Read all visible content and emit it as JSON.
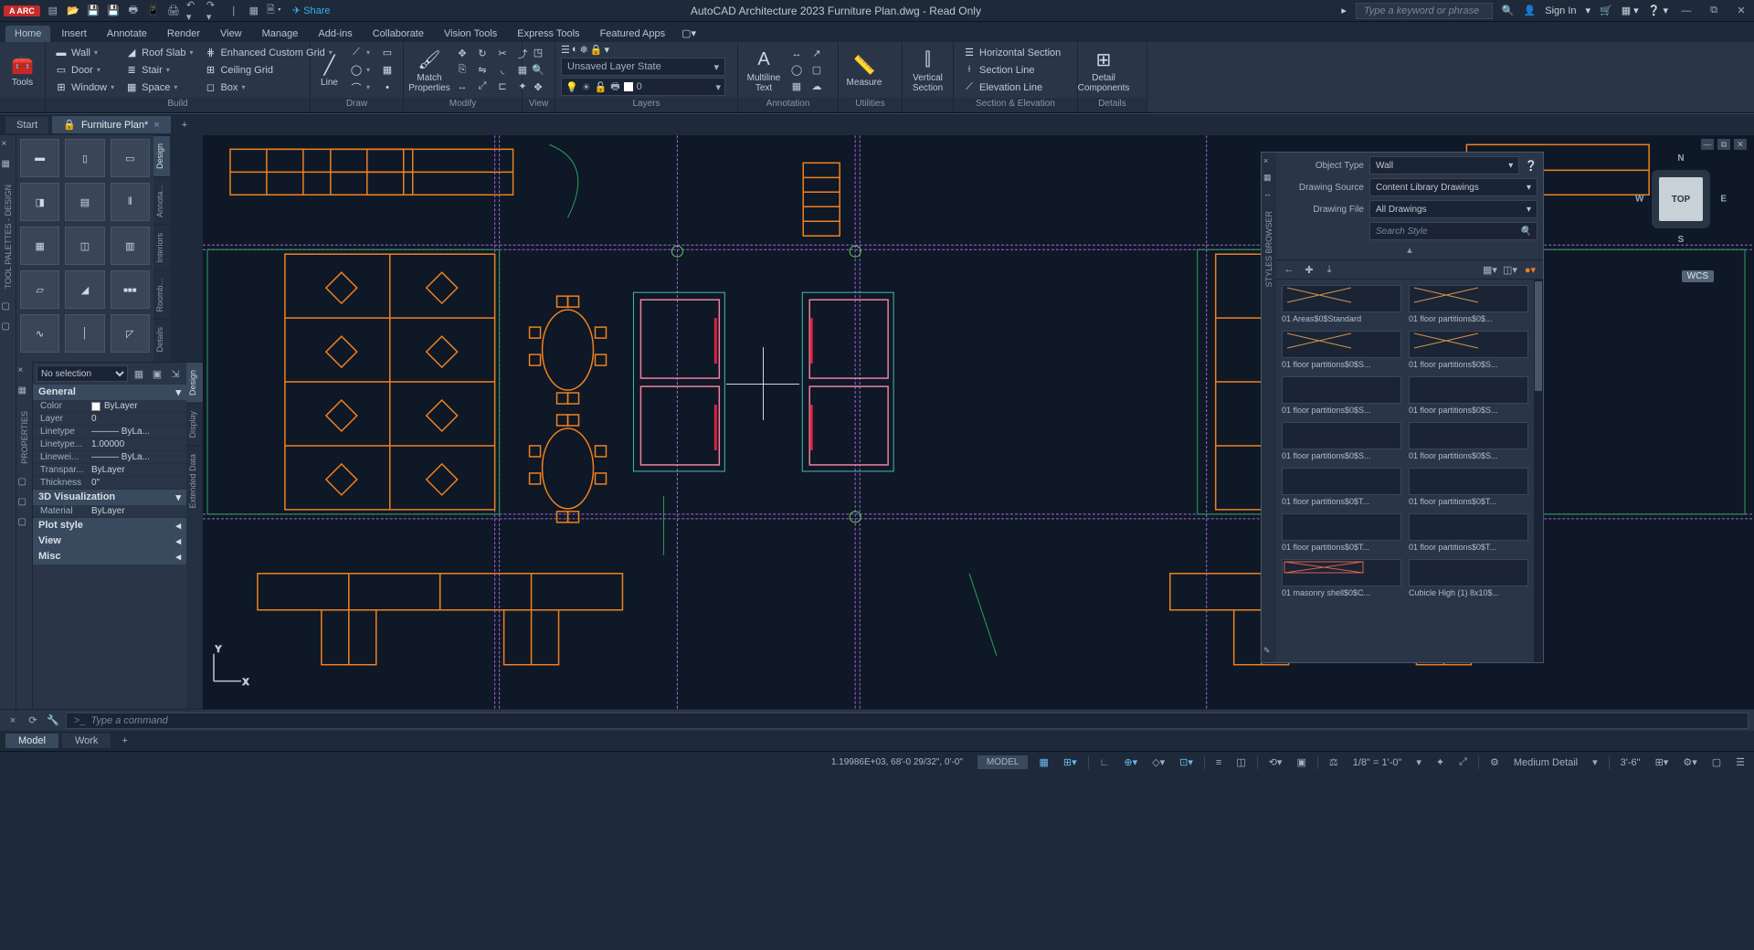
{
  "app": {
    "badge": "A ARC",
    "title": "AutoCAD Architecture 2023   Furniture Plan.dwg - Read Only",
    "share_label": "Share",
    "search_placeholder": "Type a keyword or phrase",
    "signin": "Sign In"
  },
  "menu": {
    "tabs": [
      "Home",
      "Insert",
      "Annotate",
      "Render",
      "View",
      "Manage",
      "Add-ins",
      "Collaborate",
      "Vision Tools",
      "Express Tools",
      "Featured Apps"
    ]
  },
  "ribbon": {
    "tools": "Tools",
    "build": {
      "label": "Build",
      "rows": [
        {
          "icon": "▬",
          "label": "Wall"
        },
        {
          "icon": "▭",
          "label": "Door"
        },
        {
          "icon": "⊞",
          "label": "Window"
        }
      ],
      "rows2": [
        {
          "icon": "◢",
          "label": "Roof Slab"
        },
        {
          "icon": "≣",
          "label": "Stair"
        },
        {
          "icon": "▦",
          "label": "Space"
        }
      ],
      "rows3": [
        {
          "icon": "⋕",
          "label": "Enhanced Custom Grid"
        },
        {
          "icon": "⊞",
          "label": "Ceiling Grid"
        },
        {
          "icon": "◻",
          "label": "Box"
        }
      ]
    },
    "draw": {
      "label": "Draw",
      "line": "Line"
    },
    "modify": {
      "label": "Modify",
      "match": "Match\nProperties"
    },
    "view": {
      "label": "View"
    },
    "layers": {
      "label": "Layers",
      "state": "Unsaved Layer State",
      "current": "0"
    },
    "annotation": {
      "label": "Annotation",
      "ml": "Multiline\nText"
    },
    "utilities": {
      "label": "Utilities",
      "measure": "Measure"
    },
    "section": {
      "label": "Section & Elevation",
      "vertical": "Vertical\nSection",
      "hsec": "Horizontal Section",
      "sline": "Section Line",
      "eline": "Elevation Line"
    },
    "details": {
      "label": "Details",
      "comp": "Detail\nComponents"
    }
  },
  "doctabs": {
    "start": "Start",
    "file": "Furniture Plan*"
  },
  "palettes": {
    "tabs": [
      "Design",
      "Annota...",
      "Interiors",
      "Roomb...",
      "Details",
      "Display",
      "Extended Data"
    ]
  },
  "props": {
    "sel": "No selection",
    "general": "General",
    "rows": [
      {
        "k": "Color",
        "v": "ByLayer",
        "sw": true
      },
      {
        "k": "Layer",
        "v": "0"
      },
      {
        "k": "Linetype",
        "v": "——— ByLa..."
      },
      {
        "k": "Linetype...",
        "v": "1.00000"
      },
      {
        "k": "Linewei...",
        "v": "——— ByLa..."
      },
      {
        "k": "Transpar...",
        "v": "ByLayer"
      },
      {
        "k": "Thickness",
        "v": "0\""
      }
    ],
    "viz": "3D Visualization",
    "viz_rows": [
      {
        "k": "Material",
        "v": "ByLayer"
      }
    ],
    "sections": [
      "Plot style",
      "View",
      "Misc"
    ]
  },
  "styles_browser": {
    "label": "STYLES BROWSER",
    "object_type_label": "Object Type",
    "object_type": "Wall",
    "source_label": "Drawing Source",
    "source": "Content Library Drawings",
    "file_label": "Drawing File",
    "file": "All Drawings",
    "search_placeholder": "Search Style",
    "items": [
      "01 Areas$0$Standard",
      "01 floor partitions$0$...",
      "01 floor partitions$0$S...",
      "01 floor partitions$0$S...",
      "01 floor partitions$0$S...",
      "01 floor partitions$0$S...",
      "01 floor partitions$0$S...",
      "01 floor partitions$0$S...",
      "01 floor partitions$0$T...",
      "01 floor partitions$0$T...",
      "01 floor partitions$0$T...",
      "01 floor partitions$0$T...",
      "01 masonry shell$0$C...",
      "Cubicle High (1) 8x10$..."
    ]
  },
  "viewcube": {
    "top": "TOP",
    "wcs": "WCS"
  },
  "cmd": {
    "placeholder": "Type a command",
    "prompt": ">_"
  },
  "layouts": {
    "model": "Model",
    "work": "Work"
  },
  "status": {
    "coords": "1.19986E+03, 68'-0 29/32\", 0'-0\"",
    "model": "MODEL",
    "scale": "1/8\" = 1'-0\"",
    "detail": "Medium Detail",
    "dim": "3'-6\""
  }
}
